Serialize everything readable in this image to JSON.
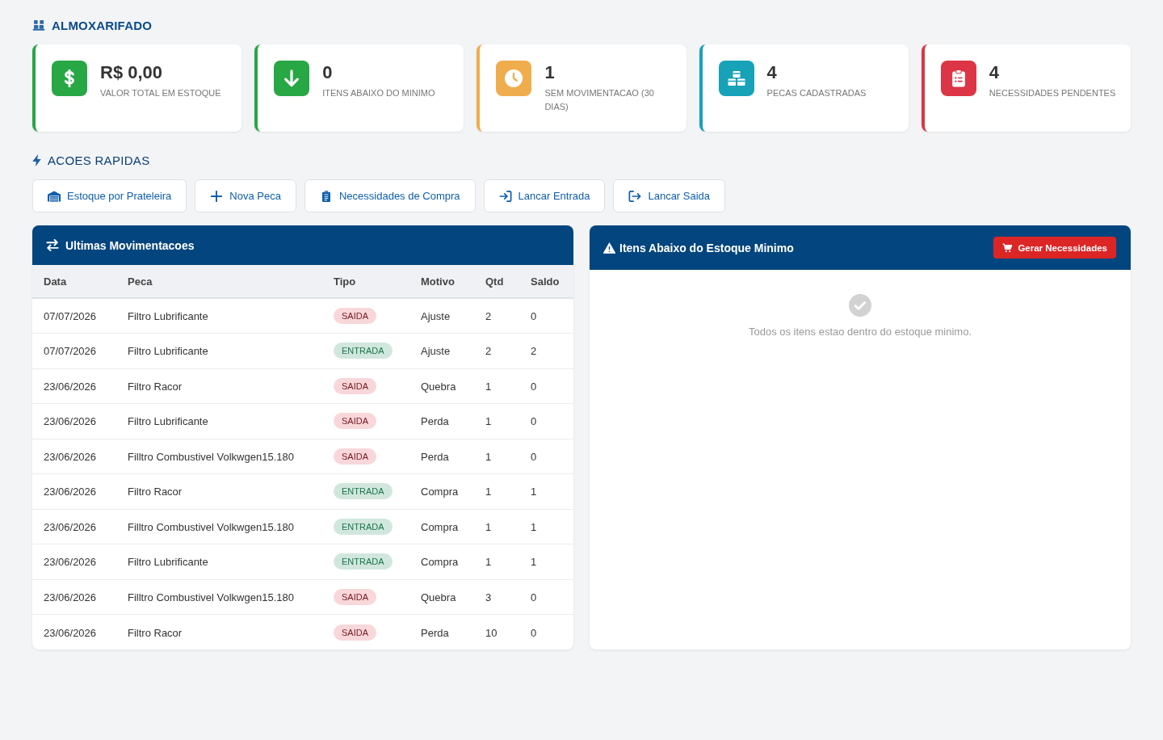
{
  "page": {
    "title": "ALMOXARIFADO"
  },
  "stats": [
    {
      "value": "R$ 0,00",
      "label": "VALOR TOTAL EM ESTOQUE",
      "color": "#28a745"
    },
    {
      "value": "0",
      "label": "ITENS ABAIXO DO MINIMO",
      "color": "#28a745"
    },
    {
      "value": "1",
      "label": "SEM MOVIMENTACAO (30 DIAS)",
      "color": "#f0ad4e"
    },
    {
      "value": "4",
      "label": "PECAS CADASTRADAS",
      "color": "#17a2b8"
    },
    {
      "value": "4",
      "label": "NECESSIDADES PENDENTES",
      "color": "#dc3545"
    }
  ],
  "quick_actions": {
    "title": "ACOES RAPIDAS",
    "buttons": [
      {
        "label": "Estoque por Prateleira"
      },
      {
        "label": "Nova Peca"
      },
      {
        "label": "Necessidades de Compra"
      },
      {
        "label": "Lancar Entrada"
      },
      {
        "label": "Lancar Saida"
      }
    ]
  },
  "movements": {
    "title": "Ultimas Movimentacoes",
    "columns": [
      "Data",
      "Peca",
      "Tipo",
      "Motivo",
      "Qtd",
      "Saldo"
    ],
    "rows": [
      {
        "data": "07/07/2026",
        "peca": "Filtro Lubrificante",
        "tipo": {
          "label": "SAIDA",
          "color": "#f8d7da"
        },
        "motivo": "Ajuste",
        "qtd": "2",
        "saldo": "0"
      },
      {
        "data": "07/07/2026",
        "peca": "Filtro Lubrificante",
        "tipo": {
          "label": "ENTRADA",
          "color": "#d1e7dd"
        },
        "motivo": "Ajuste",
        "qtd": "2",
        "saldo": "2"
      },
      {
        "data": "23/06/2026",
        "peca": "Filtro Racor",
        "tipo": {
          "label": "SAIDA",
          "color": "#f8d7da"
        },
        "motivo": "Quebra",
        "qtd": "1",
        "saldo": "0"
      },
      {
        "data": "23/06/2026",
        "peca": "Filtro Lubrificante",
        "tipo": {
          "label": "SAIDA",
          "color": "#f8d7da"
        },
        "motivo": "Perda",
        "qtd": "1",
        "saldo": "0"
      },
      {
        "data": "23/06/2026",
        "peca": "Filltro Combustivel Volkwgen15.180",
        "tipo": {
          "label": "SAIDA",
          "color": "#f8d7da"
        },
        "motivo": "Perda",
        "qtd": "1",
        "saldo": "0"
      },
      {
        "data": "23/06/2026",
        "peca": "Filtro Racor",
        "tipo": {
          "label": "ENTRADA",
          "color": "#d1e7dd"
        },
        "motivo": "Compra",
        "qtd": "1",
        "saldo": "1"
      },
      {
        "data": "23/06/2026",
        "peca": "Filltro Combustivel Volkwgen15.180",
        "tipo": {
          "label": "ENTRADA",
          "color": "#d1e7dd"
        },
        "motivo": "Compra",
        "qtd": "1",
        "saldo": "1"
      },
      {
        "data": "23/06/2026",
        "peca": "Filtro Lubrificante",
        "tipo": {
          "label": "ENTRADA",
          "color": "#d1e7dd"
        },
        "motivo": "Compra",
        "qtd": "1",
        "saldo": "1"
      },
      {
        "data": "23/06/2026",
        "peca": "Filltro Combustivel Volkwgen15.180",
        "tipo": {
          "label": "SAIDA",
          "color": "#f8d7da"
        },
        "motivo": "Quebra",
        "qtd": "3",
        "saldo": "0"
      },
      {
        "data": "23/06/2026",
        "peca": "Filtro Racor",
        "tipo": {
          "label": "SAIDA",
          "color": "#f8d7da"
        },
        "motivo": "Perda",
        "qtd": "10",
        "saldo": "0"
      }
    ]
  },
  "low_stock": {
    "title": "Itens Abaixo do Estoque Minimo",
    "button": "Gerar Necessidades",
    "empty_message": "Todos os itens estao dentro do estoque minimo."
  }
}
